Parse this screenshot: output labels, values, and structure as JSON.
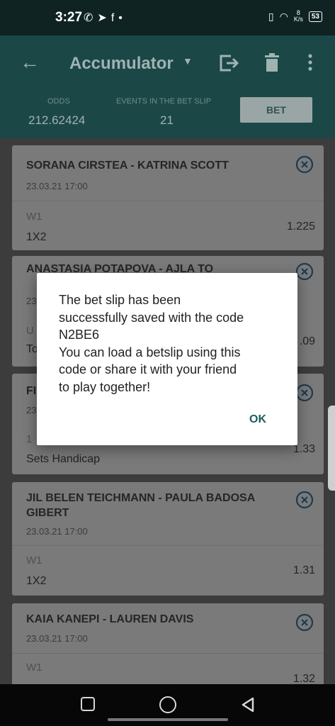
{
  "status": {
    "time": "3:27",
    "icons": [
      "whatsapp-icon",
      "telegram-icon",
      "facebook-icon",
      "dot-icon"
    ],
    "net_speed_top": "8",
    "net_speed_unit": "K/s",
    "battery": "53"
  },
  "appbar": {
    "title": "Accumulator",
    "odds_label": "ODDS",
    "odds_value": "212.62424",
    "events_label": "EVENTS IN THE BET SLIP",
    "events_value": "21",
    "bet_label": "BET"
  },
  "cards": [
    {
      "teams": "SORANA CIRSTEA - KATRINA SCOTT",
      "date": "23.03.21 17:00",
      "outcome": "W1",
      "market": "1X2",
      "odd": "1.225"
    },
    {
      "teams": "ANASTASIA POTAPOVA - AJLA TO",
      "date": "23",
      "outcome": "U",
      "market": "To",
      "odd": ".09"
    },
    {
      "teams": "FI",
      "date": "23",
      "outcome": "1",
      "market": "Sets Handicap",
      "odd": "1.33"
    },
    {
      "teams": "JIL BELEN TEICHMANN - PAULA BADOSA GIBERT",
      "date": "23.03.21 17:00",
      "outcome": "W1",
      "market": "1X2",
      "odd": "1.31"
    },
    {
      "teams": "KAIA KANEPI - LAUREN DAVIS",
      "date": "23.03.21 17:00",
      "outcome": "W1",
      "market": "",
      "odd": "1.32"
    }
  ],
  "dialog": {
    "message": "The bet slip has been\nsuccessfully saved with the code\nN2BE6\nYou can load a betslip using this\ncode or share it with your friend\nto play together!",
    "ok_label": "OK"
  },
  "colors": {
    "appbar": "#1b4747",
    "accent": "#1b5c5c"
  }
}
